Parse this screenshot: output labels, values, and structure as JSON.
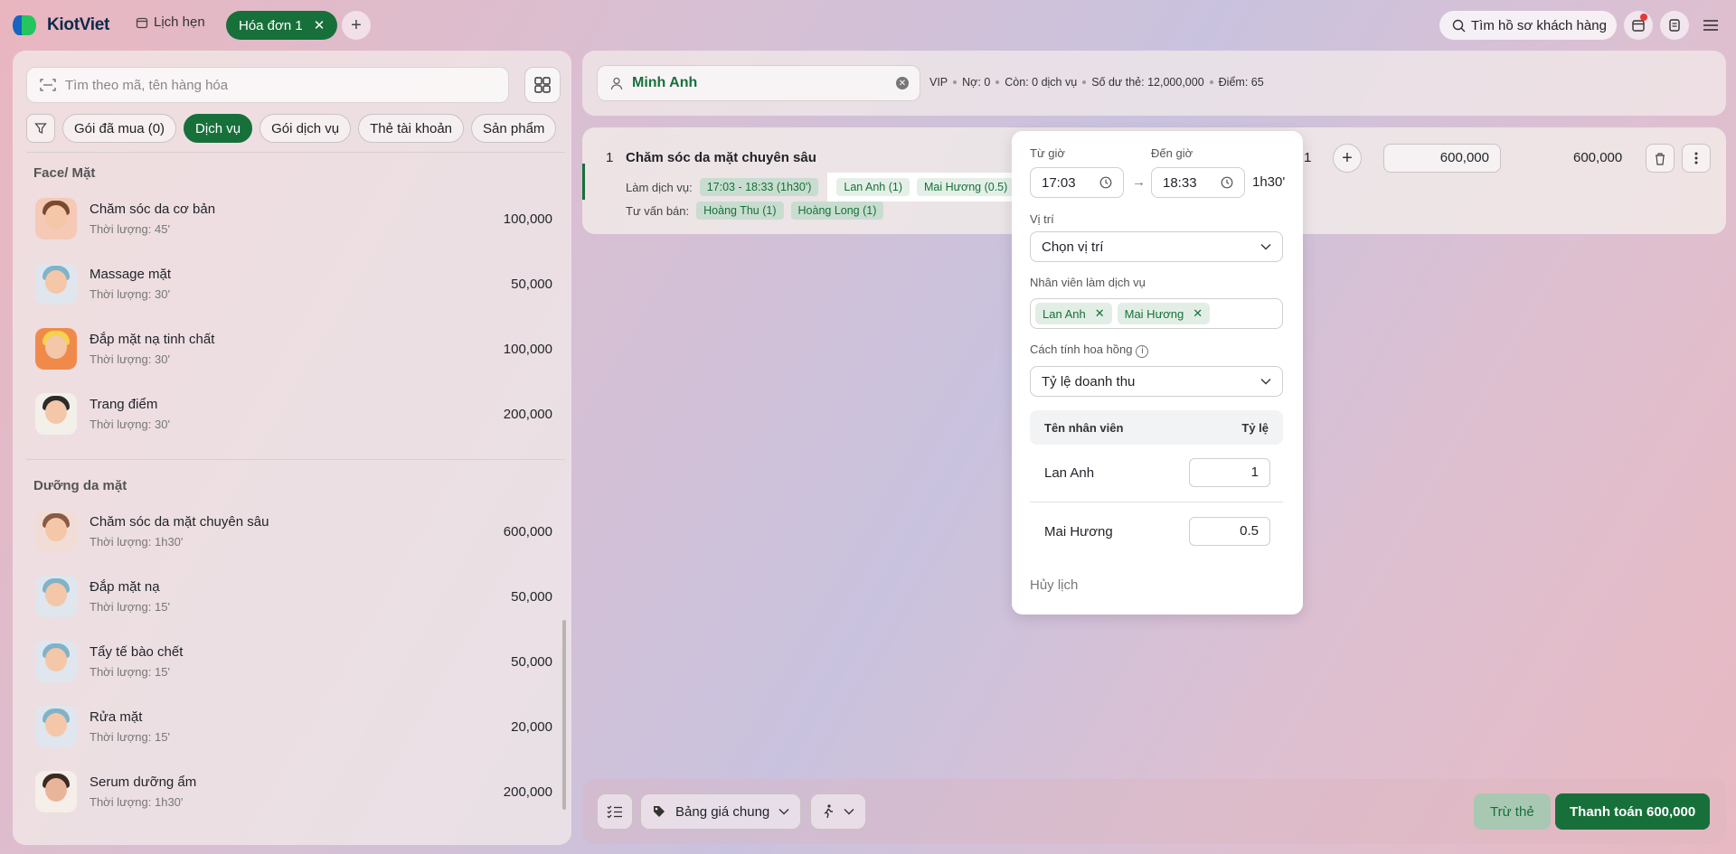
{
  "brand": {
    "name": "KiotViet"
  },
  "topbar": {
    "appointments_label": "Lịch hẹn",
    "active_tab": "Hóa đơn 1",
    "customer_search_placeholder": "Tìm hồ sơ khách hàng"
  },
  "left": {
    "search_placeholder": "Tìm theo mã, tên hàng hóa",
    "filters": [
      "Gói đã mua (0)",
      "Dịch vụ",
      "Gói dịch vụ",
      "Thẻ tài khoản",
      "Sản phẩm"
    ],
    "active_filter": "Dịch vụ",
    "sections": [
      {
        "title": "Face/ Mặt",
        "items": [
          {
            "name": "Chăm sóc da cơ bản",
            "duration": "Thời lượng: 45'",
            "price": "100,000"
          },
          {
            "name": "Massage mặt",
            "duration": "Thời lượng: 30'",
            "price": "50,000"
          },
          {
            "name": "Đắp mặt nạ tinh chất",
            "duration": "Thời lượng: 30'",
            "price": "100,000"
          },
          {
            "name": "Trang điểm",
            "duration": "Thời lượng: 30'",
            "price": "200,000"
          }
        ]
      },
      {
        "title": "Dưỡng da mặt",
        "items": [
          {
            "name": "Chăm sóc da mặt chuyên sâu",
            "duration": "Thời lượng: 1h30'",
            "price": "600,000"
          },
          {
            "name": "Đắp mặt nạ",
            "duration": "Thời lượng: 15'",
            "price": "50,000"
          },
          {
            "name": "Tẩy tế bào chết",
            "duration": "Thời lượng: 15'",
            "price": "50,000"
          },
          {
            "name": "Rửa mặt",
            "duration": "Thời lượng: 15'",
            "price": "20,000"
          },
          {
            "name": "Serum dưỡng ẩm",
            "duration": "Thời lượng: 1h30'",
            "price": "200,000"
          }
        ]
      }
    ]
  },
  "customer": {
    "name": "Minh Anh",
    "meta": [
      "VIP",
      "Nợ: 0",
      "Còn: 0 dịch vụ",
      "Số dư thẻ: 12,000,000",
      "Điểm: 65"
    ]
  },
  "line": {
    "index": "1",
    "name": "Chăm sóc da mặt chuyên sâu",
    "service_label": "Làm dịch vụ:",
    "time_tag": "17:03 - 18:33 (1h30')",
    "staff_tags": [
      "Lan Anh (1)",
      "Mai Hương (0.5)"
    ],
    "advisor_label": "Tư vấn bán:",
    "advisor_tags": [
      "Hoàng Thu (1)",
      "Hoàng Long (1)"
    ],
    "qty": "1",
    "unit_price": "600,000",
    "total": "600,000"
  },
  "popover": {
    "from_label": "Từ giờ",
    "from_value": "17:03",
    "to_label": "Đến giờ",
    "to_value": "18:33",
    "duration": "1h30'",
    "location_label": "Vị trí",
    "location_value": "Chọn vị trí",
    "staff_label": "Nhân viên làm dịch vụ",
    "staff": [
      "Lan Anh",
      "Mai Hương"
    ],
    "commission_label": "Cách tính hoa hồng",
    "commission_value": "Tỷ lệ doanh thu",
    "table_head_name": "Tên nhân viên",
    "table_head_ratio": "Tỷ lệ",
    "rows": [
      {
        "name": "Lan Anh",
        "ratio": "1"
      },
      {
        "name": "Mai Hương",
        "ratio": "0.5"
      }
    ],
    "cancel_label": "Hủy lịch"
  },
  "bottom": {
    "price_list": "Bảng giá chung",
    "deduct_card": "Trừ thẻ",
    "pay_button": "Thanh toán 600,000"
  },
  "colors": {
    "brand_green": "#17703a",
    "alert": "#e53935"
  }
}
